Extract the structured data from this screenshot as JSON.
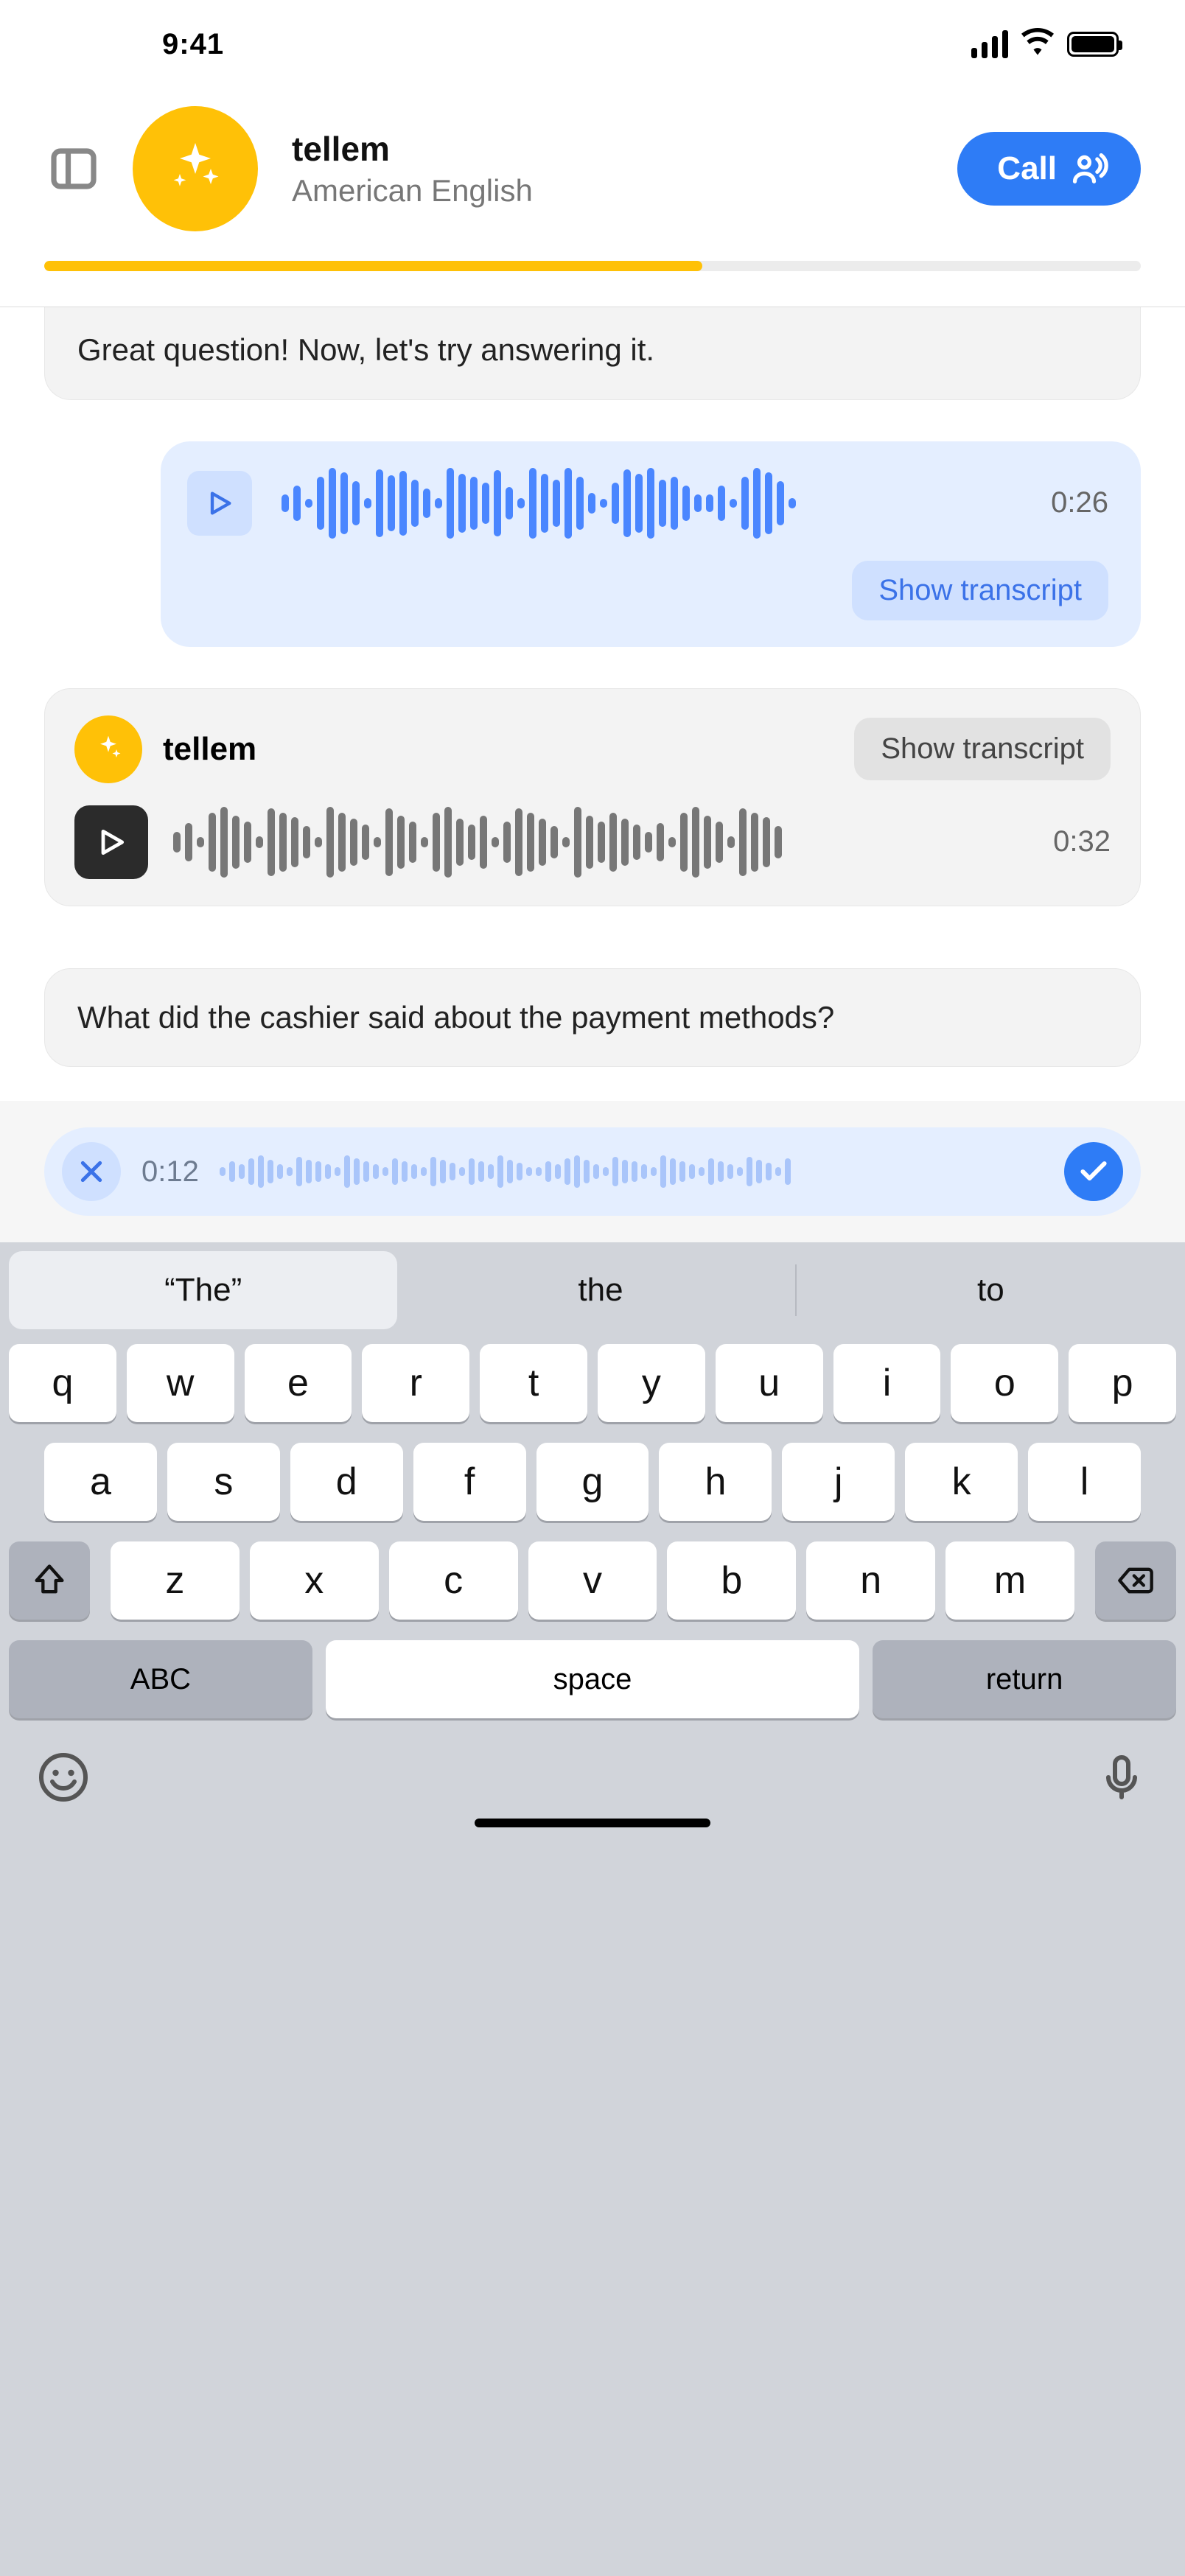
{
  "status": {
    "time": "9:41"
  },
  "header": {
    "title": "tellem",
    "subtitle": "American English",
    "call_label": "Call",
    "progress_pct": 60
  },
  "chat": {
    "msg1_text": "Great question! Now, let's try answering it.",
    "blue_voice": {
      "duration": "0:26",
      "transcript_btn": "Show transcript"
    },
    "tellem_voice": {
      "name": "tellem",
      "transcript_btn": "Show transcript",
      "duration": "0:32"
    },
    "msg2_text": "What did the cashier said about the payment methods?",
    "composer": {
      "time": "0:12"
    }
  },
  "keyboard": {
    "suggestions": [
      "“The”",
      "the",
      "to"
    ],
    "row1": [
      "q",
      "w",
      "e",
      "r",
      "t",
      "y",
      "u",
      "i",
      "o",
      "p"
    ],
    "row2": [
      "a",
      "s",
      "d",
      "f",
      "g",
      "h",
      "j",
      "k",
      "l"
    ],
    "row3": [
      "z",
      "x",
      "c",
      "v",
      "b",
      "n",
      "m"
    ],
    "abc": "ABC",
    "space": "space",
    "return": "return"
  }
}
